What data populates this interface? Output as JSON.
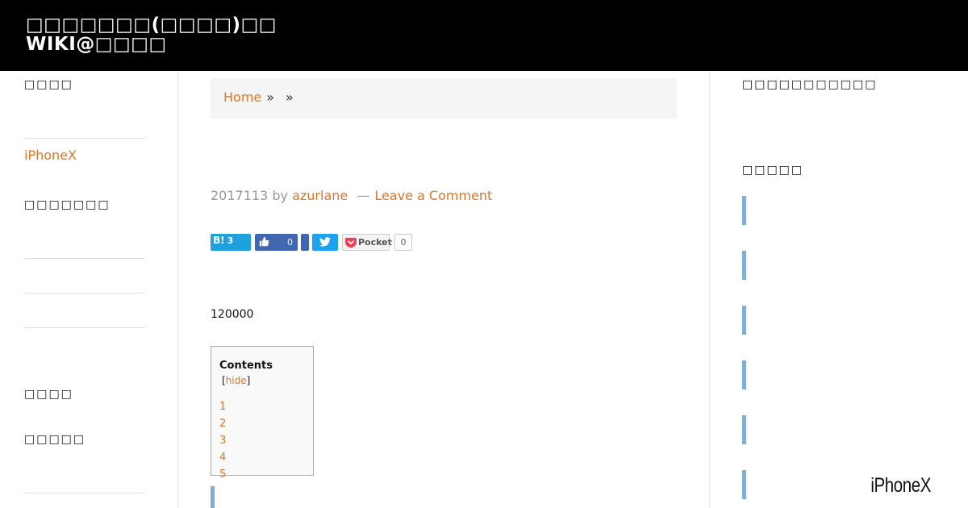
{
  "header": {
    "site_title": "□□□□□□□(□□□□)□□WIKI@□□□□",
    "background_color": "#000000"
  },
  "sidebar_left": {
    "heading_1": "□□□□",
    "link_1": "iPhoneX",
    "heading_2": "□□□□□□□",
    "heading_3": "□□□□",
    "heading_4": "□□□□□"
  },
  "breadcrumb": {
    "home_label": "Home",
    "separator": "»"
  },
  "entry_meta": {
    "date": "2017113",
    "by_label": "by",
    "author": "azurlane",
    "dash": "—",
    "comment_link": "Leave a Comment"
  },
  "share": {
    "hatena_label": "B!",
    "hatena_count": "3",
    "fb_like_count": "0",
    "pocket_label": "Pocket",
    "pocket_count": "0"
  },
  "content": {
    "body_text": "120000"
  },
  "toc": {
    "title": "Contents",
    "toggle_open": "[",
    "toggle_label": "hide",
    "toggle_close": "]",
    "items": [
      "1",
      "2",
      "3",
      "4",
      "5"
    ]
  },
  "sidebar_right": {
    "heading_1": "□□□□□□□□□□□",
    "heading_2": "□□□□□"
  },
  "promo": {
    "label": "iPhoneX"
  },
  "colors": {
    "accent": "#e0762b",
    "muted": "#999999",
    "quote_bar": "#7fafd6",
    "hatena": "#1fa1e0",
    "facebook": "#4267b2",
    "twitter": "#1da1f2"
  }
}
